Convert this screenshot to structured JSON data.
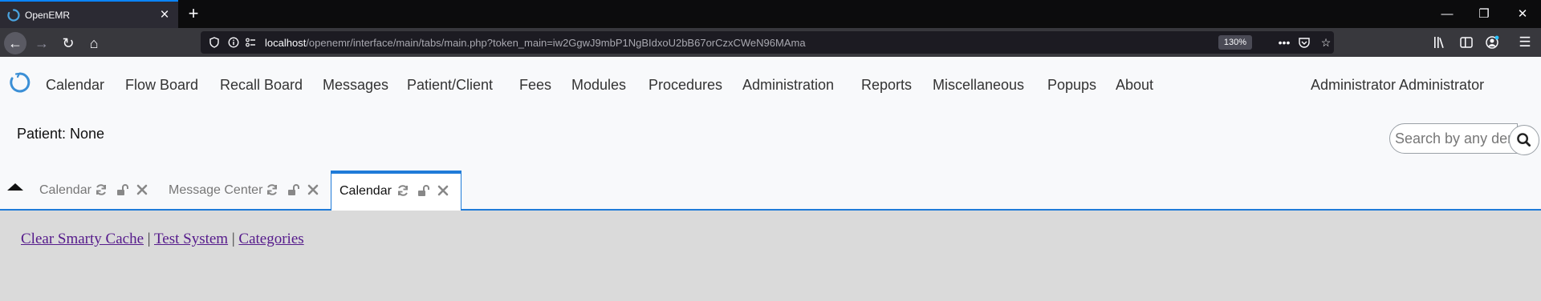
{
  "browser": {
    "tab_title": "OpenEMR",
    "url_host": "localhost",
    "url_rest": "/openemr/interface/main/tabs/main.php?token_main=iw2GgwJ9mbP1NgBIdxoU2bB67orCzxCWeN96MAma",
    "zoom": "130%",
    "icons": [
      "back-icon",
      "forward-icon",
      "reload-icon",
      "home-icon",
      "shield-icon",
      "info-icon",
      "page-actions-icon",
      "pocket-icon",
      "bookmark-star-icon",
      "library-icon",
      "sidebar-icon",
      "account-icon",
      "hamburger-menu-icon"
    ]
  },
  "menu": {
    "items": [
      "Calendar",
      "Flow Board",
      "Recall Board",
      "Messages",
      "Patient/Client",
      "Fees",
      "Modules",
      "Procedures",
      "Administration",
      "Reports",
      "Miscellaneous",
      "Popups",
      "About"
    ],
    "user": "Administrator Administrator"
  },
  "patient": {
    "label": "Patient: None",
    "search_placeholder": "Search by any demographics"
  },
  "tabs": [
    {
      "label": "Calendar",
      "active": false
    },
    {
      "label": "Message Center",
      "active": false
    },
    {
      "label": "Calendar",
      "active": true
    }
  ],
  "content": {
    "links": [
      "Clear Smarty Cache",
      "Test System",
      "Categories"
    ],
    "separator": "|"
  },
  "colors": {
    "accent": "#1f7bd8",
    "visited_link": "#551a8b",
    "content_bg": "#dadada"
  }
}
